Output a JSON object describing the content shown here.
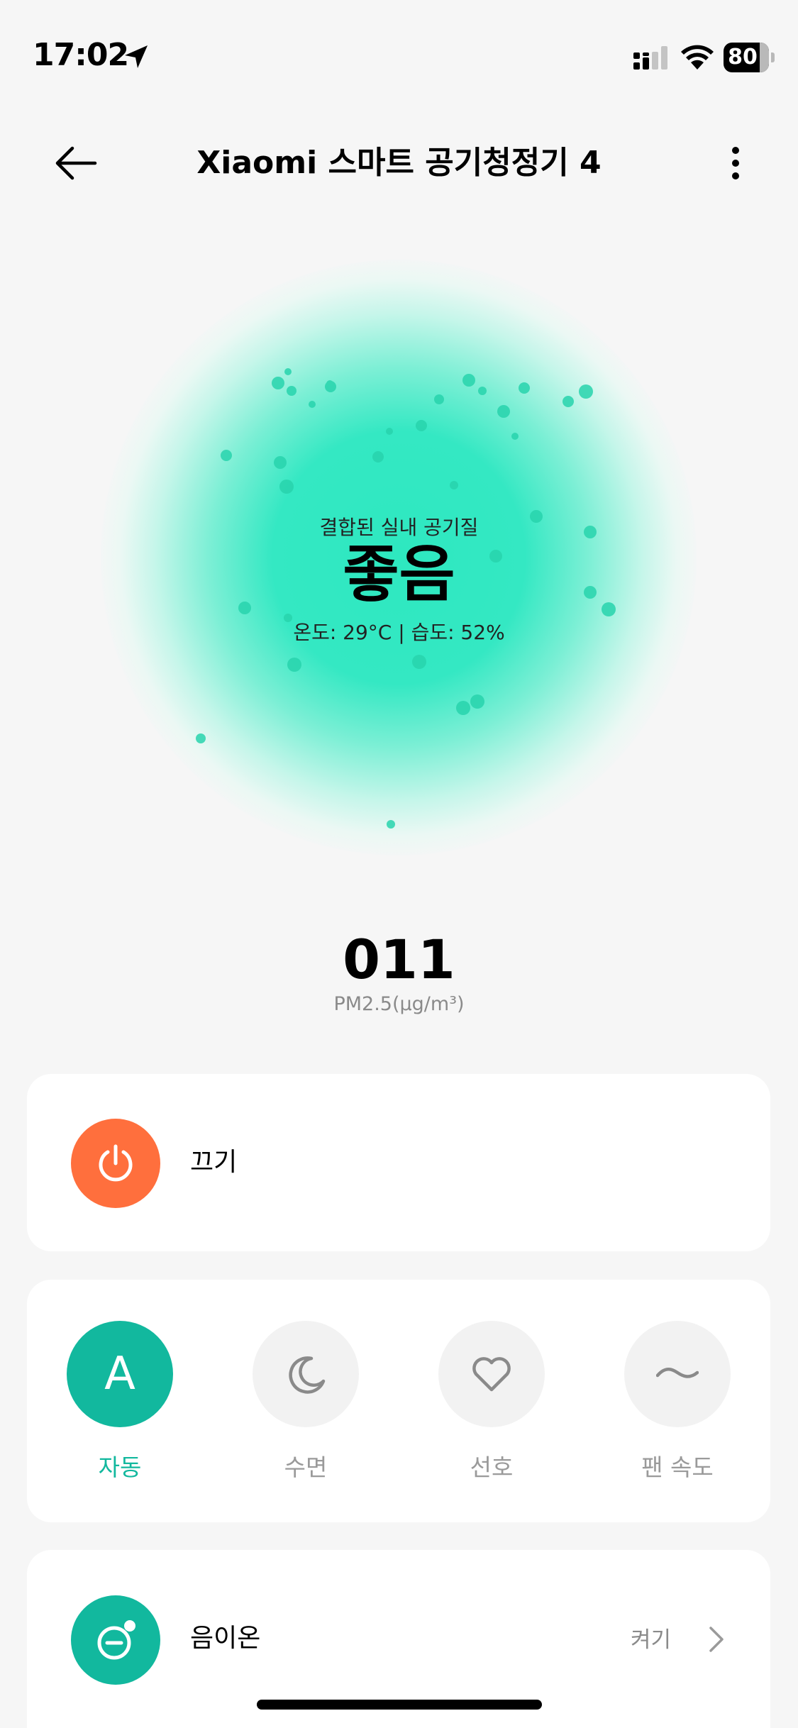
{
  "status_bar": {
    "time": "17:02",
    "battery": "80"
  },
  "header": {
    "title": "Xiaomi 스마트 공기청정기 4"
  },
  "air_quality": {
    "label": "결합된 실내 공기질",
    "status": "좋음",
    "meta": "온도: 29°C | 습도: 52%"
  },
  "pm25": {
    "value": "011",
    "unit": "PM2.5(μg/m³)"
  },
  "power": {
    "label": "끄기",
    "color": "#ff6f3d"
  },
  "modes": [
    {
      "label": "자동",
      "icon": "auto-icon",
      "letter": "A",
      "active": true
    },
    {
      "label": "수면",
      "icon": "moon-icon",
      "active": false
    },
    {
      "label": "선호",
      "icon": "heart-icon",
      "active": false
    },
    {
      "label": "팬 속도",
      "icon": "wave-icon",
      "active": false
    }
  ],
  "ion": {
    "label": "음이온",
    "value": "켜기"
  },
  "colors": {
    "accent": "#12b89e",
    "power": "#ff6f3d",
    "glow": "#2ee8c0"
  }
}
